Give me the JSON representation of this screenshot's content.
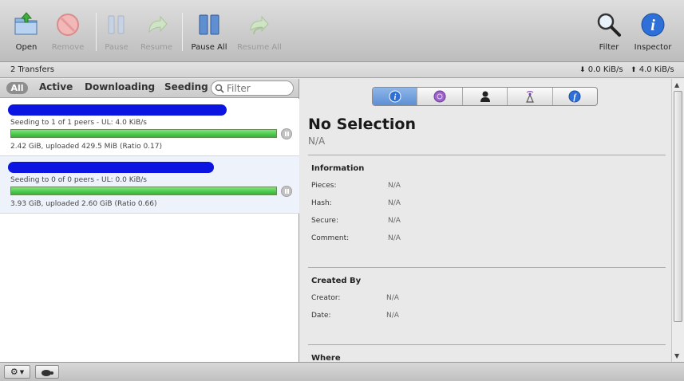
{
  "toolbar": {
    "open": "Open",
    "remove": "Remove",
    "pause": "Pause",
    "resume": "Resume",
    "pause_all": "Pause All",
    "resume_all": "Resume All",
    "filter": "Filter",
    "inspector": "Inspector"
  },
  "status": {
    "transfers": "2 Transfers",
    "download_speed": "0.0 KiB/s",
    "upload_speed": "4.0 KiB/s"
  },
  "filters": {
    "all": "All",
    "active": "Active",
    "downloading": "Downloading",
    "seeding": "Seeding",
    "search_placeholder": "Filter"
  },
  "transfers": [
    {
      "status": "Seeding to 1 of 1 peers - UL: 4.0 KiB/s",
      "progress_percent": 100,
      "summary": "2.42 GiB, uploaded 429.5 MiB (Ratio 0.17)"
    },
    {
      "status": "Seeding to 0 of 0 peers - UL: 0.0 KiB/s",
      "progress_percent": 100,
      "summary": "3.93 GiB, uploaded 2.60 GiB (Ratio 0.66)"
    }
  ],
  "inspector": {
    "tabs": [
      "info-icon",
      "activity-icon",
      "peers-icon",
      "trackers-icon",
      "files-icon"
    ],
    "title": "No Selection",
    "subtitle": "N/A",
    "information": {
      "heading": "Information",
      "pieces_label": "Pieces:",
      "pieces_value": "N/A",
      "hash_label": "Hash:",
      "hash_value": "N/A",
      "secure_label": "Secure:",
      "secure_value": "N/A",
      "comment_label": "Comment:",
      "comment_value": "N/A"
    },
    "created_by": {
      "heading": "Created By",
      "creator_label": "Creator:",
      "creator_value": "N/A",
      "date_label": "Date:",
      "date_value": "N/A"
    },
    "where": {
      "heading": "Where"
    }
  },
  "colors": {
    "accent_blue": "#2f6fd8",
    "progress_green": "#2fb533",
    "redaction_blue": "#0b14e0"
  }
}
